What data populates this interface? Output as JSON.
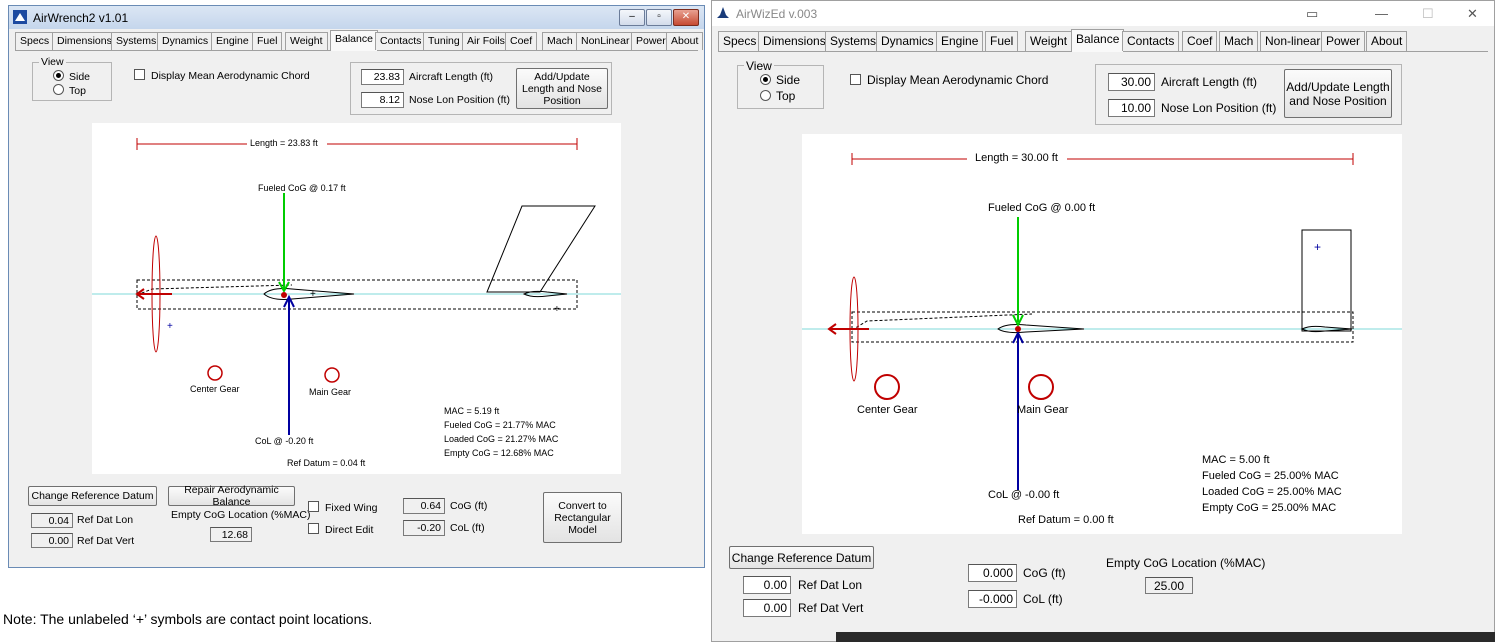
{
  "win1": {
    "title": "AirWrench2 v1.01",
    "tabs": [
      "Specs",
      "Dimensions",
      "Systems",
      "Dynamics",
      "Engine",
      "Fuel",
      "Weight",
      "Balance",
      "Contacts",
      "Tuning",
      "Air Foils",
      "Coef",
      "Mach",
      "NonLinear",
      "Power",
      "About"
    ],
    "view_title": "View",
    "view_side": "Side",
    "view_top": "Top",
    "display_mac": "Display Mean Aerodynamic Chord",
    "aircraft_length_value": "23.83",
    "aircraft_length_label": "Aircraft Length (ft)",
    "nose_lon_value": "8.12",
    "nose_lon_label": "Nose Lon Position (ft)",
    "add_update_btn": "Add/Update Length and Nose Position",
    "canvas": {
      "length_label": "Length = 23.83 ft",
      "fueled_cog_label": "Fueled CoG @ 0.17 ft",
      "center_gear": "Center Gear",
      "main_gear": "Main Gear",
      "col_label": "CoL @ -0.20 ft",
      "ref_datum": "Ref Datum = 0.04 ft",
      "mac": "MAC = 5.19 ft",
      "fueled_cog_mac": "Fueled CoG = 21.77% MAC",
      "loaded_cog_mac": "Loaded CoG = 21.27% MAC",
      "empty_cog_mac": "Empty CoG = 12.68% MAC"
    },
    "change_ref_btn": "Change Reference Datum",
    "repair_btn": "Repair Aerodynamic Balance",
    "ref_dat_lon_value": "0.04",
    "ref_dat_lon_label": "Ref Dat Lon",
    "ref_dat_vert_value": "0.00",
    "ref_dat_vert_label": "Ref Dat Vert",
    "empty_cog_loc_label": "Empty CoG Location (%MAC)",
    "empty_cog_loc_value": "12.68",
    "fixed_wing": "Fixed Wing",
    "direct_edit": "Direct Edit",
    "cog_value": "0.64",
    "cog_label": "CoG (ft)",
    "col_value": "-0.20",
    "col_label": "CoL (ft)",
    "convert_btn": "Convert to Rectangular Model"
  },
  "win2": {
    "title": "AirWizEd v.003",
    "tabs": [
      "Specs",
      "Dimensions",
      "Systems",
      "Dynamics",
      "Engine",
      "Fuel",
      "Weight",
      "Balance",
      "Contacts",
      "Coef",
      "Mach",
      "Non-linear",
      "Power",
      "About"
    ],
    "view_title": "View",
    "view_side": "Side",
    "view_top": "Top",
    "display_mac": "Display Mean Aerodynamic Chord",
    "aircraft_length_value": "30.00",
    "aircraft_length_label": "Aircraft Length (ft)",
    "nose_lon_value": "10.00",
    "nose_lon_label": "Nose Lon Position (ft)",
    "add_update_btn": "Add/Update Length and Nose Position",
    "canvas": {
      "length_label": "Length = 30.00 ft",
      "fueled_cog_label": "Fueled CoG @ 0.00 ft",
      "center_gear": "Center Gear",
      "main_gear": "Main Gear",
      "col_label": "CoL @ -0.00 ft",
      "ref_datum": "Ref Datum = 0.00 ft",
      "mac": "MAC = 5.00 ft",
      "fueled_cog_mac": "Fueled CoG = 25.00% MAC",
      "loaded_cog_mac": "Loaded CoG = 25.00% MAC",
      "empty_cog_mac": "Empty CoG = 25.00% MAC"
    },
    "change_ref_btn": "Change Reference Datum",
    "ref_dat_lon_value": "0.00",
    "ref_dat_lon_label": "Ref Dat Lon",
    "ref_dat_vert_value": "0.00",
    "ref_dat_vert_label": "Ref Dat Vert",
    "cog_value": "0.000",
    "cog_label": "CoG (ft)",
    "col_value": "-0.000",
    "col_label": "CoL (ft)",
    "empty_cog_loc_label": "Empty CoG Location (%MAC)",
    "empty_cog_loc_value": "25.00"
  },
  "note": "Note: The unlabeled ‘+’ symbols are contact point locations."
}
